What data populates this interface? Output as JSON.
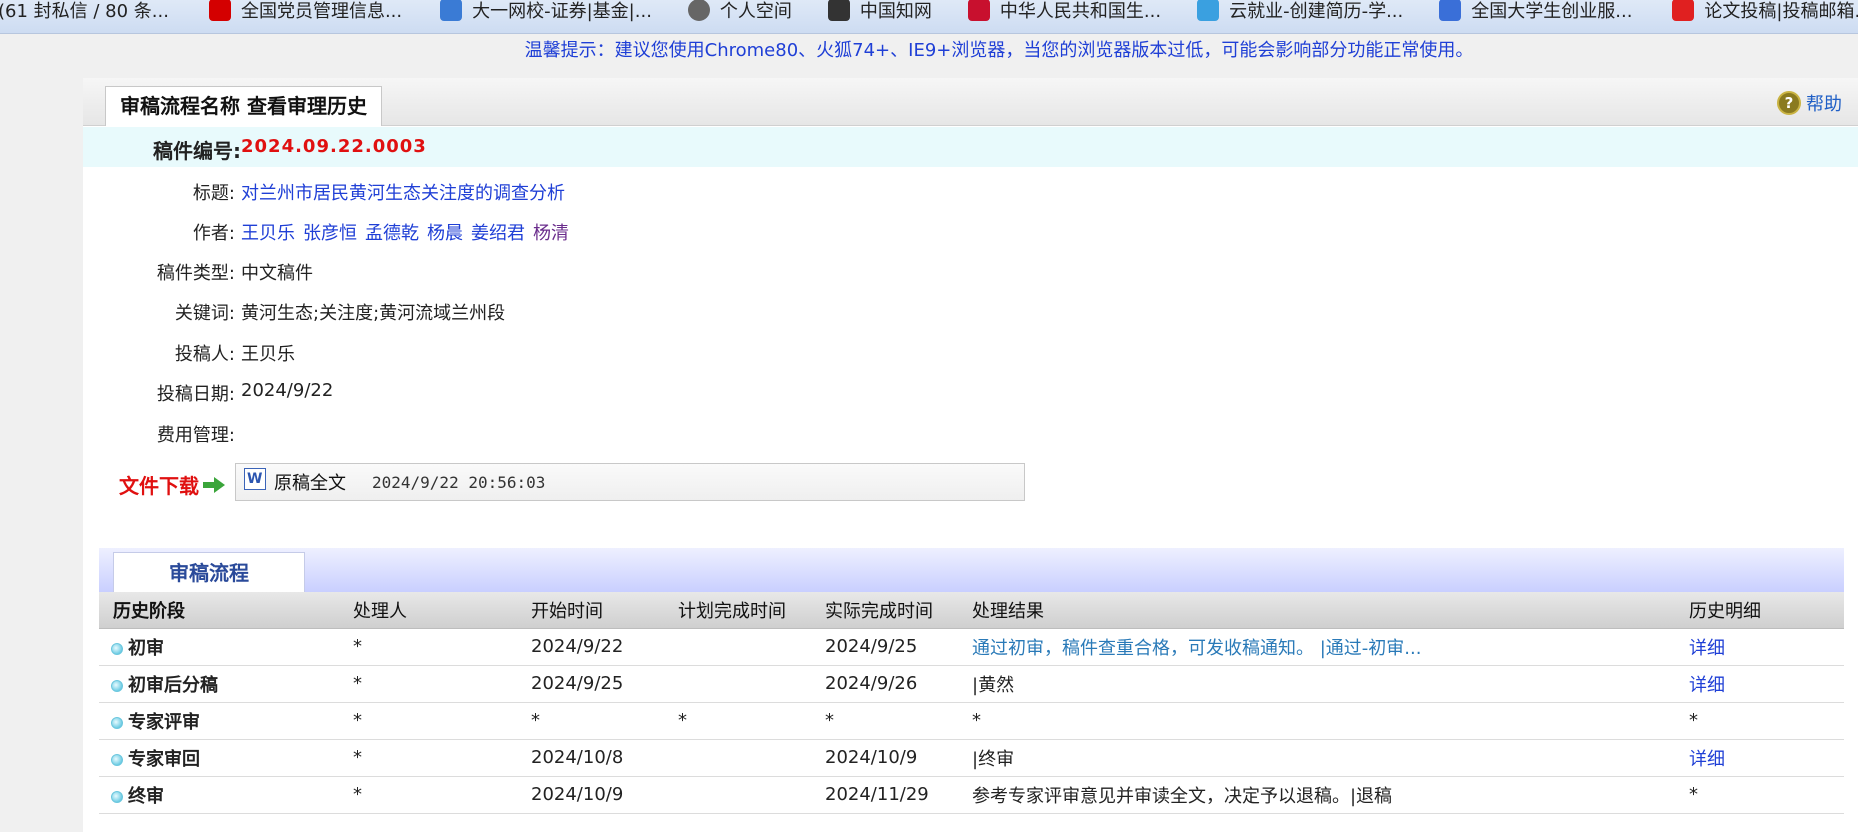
{
  "bookmarks": [
    {
      "label": "(61 封私信 / 80 条...",
      "icon": "none",
      "color": ""
    },
    {
      "label": "全国党员管理信息...",
      "icon": "party-emblem-icon",
      "color": "#d40000"
    },
    {
      "label": "大一网校-证券|基金|...",
      "icon": "school-icon",
      "color": "#3a7bd5"
    },
    {
      "label": "个人空间",
      "icon": "globe-icon",
      "color": "#666666"
    },
    {
      "label": "中国知网",
      "icon": "cnki-icon",
      "color": "#333333"
    },
    {
      "label": "中华人民共和国生...",
      "icon": "national-emblem-icon",
      "color": "#c8102e"
    },
    {
      "label": "云就业-创建简历-学...",
      "icon": "cloud-icon",
      "color": "#3aa0e0"
    },
    {
      "label": "全国大学生创业服...",
      "icon": "service-icon",
      "color": "#3a6fd8"
    },
    {
      "label": "论文投稿|投稿邮箱...",
      "icon": "journal-icon",
      "color": "#e02020"
    }
  ],
  "notice": "温馨提示：建议您使用Chrome80、火狐74+、IE9+浏览器，当您的浏览器版本过低，可能会影响部分功能正常使用。",
  "header": {
    "title": "审稿流程名称 查看审理历史",
    "help_label": "帮助"
  },
  "manuscript": {
    "id_label": "稿件编号:",
    "id_value": "2024.09.22.0003",
    "fields": {
      "title_label": "标题:",
      "title_value": "对兰州市居民黄河生态关注度的调查分析",
      "authors_label": "作者:",
      "authors": [
        "王贝乐",
        "张彦恒",
        "孟德乾",
        "杨晨",
        "姜绍君",
        "杨清"
      ],
      "type_label": "稿件类型:",
      "type_value": "中文稿件",
      "keywords_label": "关键词:",
      "keywords_value": "黄河生态;关注度;黄河流域兰州段",
      "submitter_label": "投稿人:",
      "submitter_value": "王贝乐",
      "date_label": "投稿日期:",
      "date_value": "2024/9/22",
      "fee_label": "费用管理:",
      "fee_value": ""
    }
  },
  "download": {
    "label": "文件下载",
    "file_name": "原稿全文",
    "file_time": "2024/9/22 20:56:03"
  },
  "flow": {
    "tab_label": "审稿流程",
    "columns": [
      "历史阶段",
      "处理人",
      "开始时间",
      "计划完成时间",
      "实际完成时间",
      "处理结果",
      "历史明细"
    ],
    "rows": [
      {
        "stage": "初审",
        "handler": "*",
        "start": "2024/9/22",
        "planned": "",
        "actual": "2024/9/25",
        "result": "通过初审，稿件查重合格，可发收稿通知。 |通过-初审...",
        "detail": "详细"
      },
      {
        "stage": "初审后分稿",
        "handler": "*",
        "start": "2024/9/25",
        "planned": "",
        "actual": "2024/9/26",
        "result": "|黄然",
        "detail": "详细"
      },
      {
        "stage": "专家评审",
        "handler": "*",
        "start": "*",
        "planned": "*",
        "actual": "*",
        "result": "*",
        "detail": "*"
      },
      {
        "stage": "专家审回",
        "handler": "*",
        "start": "2024/10/8",
        "planned": "",
        "actual": "2024/10/9",
        "result": "|终审",
        "detail": "详细"
      },
      {
        "stage": "终审",
        "handler": "*",
        "start": "2024/10/9",
        "planned": "",
        "actual": "2024/11/29",
        "result": "参考专家评审意见并审读全文，决定予以退稿。|退稿",
        "detail": "*"
      }
    ]
  }
}
